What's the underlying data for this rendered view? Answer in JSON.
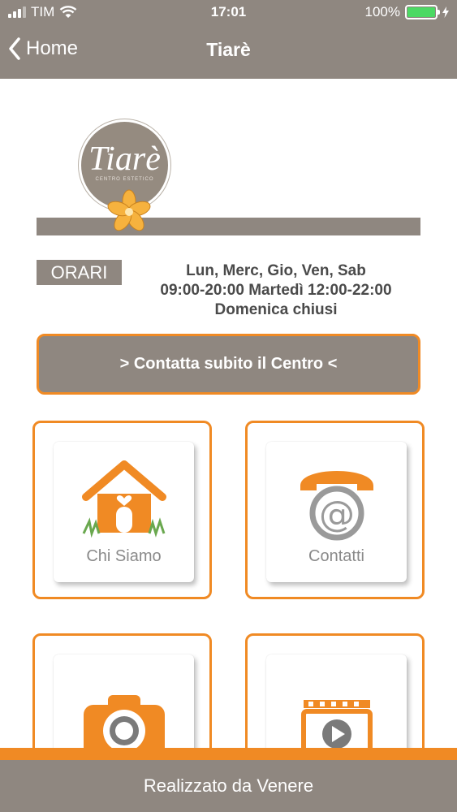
{
  "status_bar": {
    "carrier": "TIM",
    "time": "17:01",
    "battery": "100%",
    "battery_level": 1.0
  },
  "nav": {
    "back_label": "Home",
    "title": "Tiarè"
  },
  "logo": {
    "text": "Tiarè",
    "subtext": "CENTRO ESTETICO"
  },
  "orari": {
    "label": "ORARI",
    "line1": "Lun, Merc, Gio, Ven, Sab",
    "line2": "09:00-20:00 Martedì 12:00-22:00",
    "line3": "Domenica chiusi"
  },
  "contact_button": {
    "label": "> Contatta subito il Centro <"
  },
  "tiles": [
    {
      "label": "Chi Siamo",
      "icon": "house-icon"
    },
    {
      "label": "Contatti",
      "icon": "phone-at-icon"
    },
    {
      "label": "",
      "icon": "camera-icon"
    },
    {
      "label": "",
      "icon": "video-icon"
    }
  ],
  "footer": {
    "text": "Realizzato da Venere"
  },
  "colors": {
    "accent": "#f08a24",
    "bar": "#8f8780",
    "battery": "#4cd964"
  }
}
